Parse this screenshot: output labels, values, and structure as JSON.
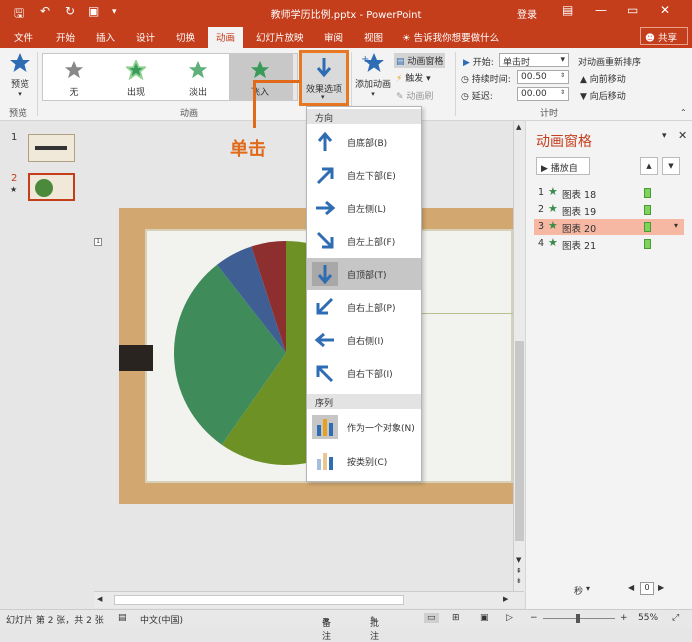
{
  "window": {
    "title": "教师学历比例.pptx - PowerPoint",
    "login": "登录",
    "minimize": "—",
    "restore": "▭",
    "close": "✕"
  },
  "tabs": [
    "文件",
    "开始",
    "插入",
    "设计",
    "切换",
    "动画",
    "幻灯片放映",
    "审阅",
    "视图"
  ],
  "active_tab": "动画",
  "tell_me": "告诉我你想要做什么",
  "share": "共享",
  "ribbon": {
    "preview": {
      "label": "预览",
      "group": "预览"
    },
    "animation_gallery": {
      "group": "动画",
      "items": [
        {
          "label": "无"
        },
        {
          "label": "出现"
        },
        {
          "label": "淡出"
        },
        {
          "label": "飞入"
        }
      ],
      "selected": "飞入"
    },
    "effect_options": "效果选项",
    "add_animation": "添加动画",
    "animation_pane": "动画窗格",
    "trigger": "触发",
    "animation_painter": "动画刷",
    "timing": {
      "group": "计时",
      "start_label": "开始:",
      "start_value": "单击时",
      "duration_label": "持续时间:",
      "duration_value": "00.50",
      "delay_label": "延迟:",
      "delay_value": "00.00",
      "reorder_title": "对动画重新排序",
      "move_earlier": "向前移动",
      "move_later": "向后移动"
    }
  },
  "callout": "单击",
  "effect_menu": {
    "direction_header": "方向",
    "directions": [
      {
        "label": "自底部(B)",
        "icon": "arrow-up-icon"
      },
      {
        "label": "自左下部(E)",
        "icon": "arrow-up-right-icon"
      },
      {
        "label": "自左侧(L)",
        "icon": "arrow-right-icon"
      },
      {
        "label": "自左上部(F)",
        "icon": "arrow-down-right-icon"
      },
      {
        "label": "自顶部(T)",
        "icon": "arrow-down-icon"
      },
      {
        "label": "自右上部(P)",
        "icon": "arrow-down-left-icon"
      },
      {
        "label": "自右侧(I)",
        "icon": "arrow-left-icon"
      },
      {
        "label": "自右下部(I)",
        "icon": "arrow-up-left-icon"
      }
    ],
    "highlighted": "自顶部(T)",
    "sequence_header": "序列",
    "sequences": [
      {
        "label": "作为一个对象(N)",
        "icon": "one-object-icon"
      },
      {
        "label": "按类别(C)",
        "icon": "by-category-icon"
      }
    ]
  },
  "thumbnails": [
    {
      "number": "1"
    },
    {
      "number": "2"
    }
  ],
  "animation_pane": {
    "title": "动画窗格",
    "play_from": "播放自",
    "items": [
      {
        "number": "1",
        "name": "图表 18"
      },
      {
        "number": "2",
        "name": "图表 19"
      },
      {
        "number": "3",
        "name": "图表 20"
      },
      {
        "number": "4",
        "name": "图表 21"
      }
    ],
    "selected": "图表 20",
    "seconds_label": "秒",
    "seconds_value": "0"
  },
  "status": {
    "slide_info": "幻灯片 第 2 张，共 2 张",
    "language": "中文(中国)",
    "notes": "备注",
    "comments": "批注",
    "zoom": "55%"
  },
  "colors": {
    "accent": "#c43e1c",
    "highlight_border": "#e87722",
    "pie_green": "#3f8b5a",
    "pie_olive": "#6d9124",
    "pie_blue": "#3f5f94",
    "pie_red": "#8e2f2f"
  }
}
